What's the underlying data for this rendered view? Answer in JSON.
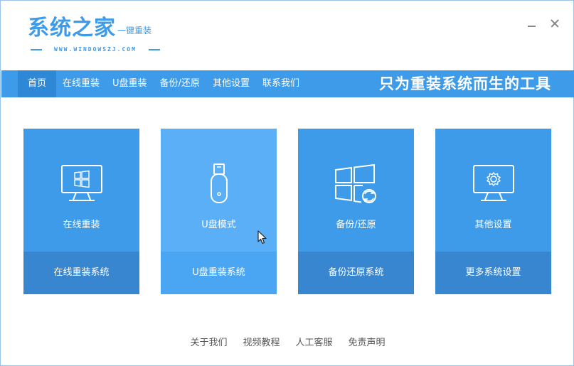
{
  "app": {
    "logo_title": "系统之家",
    "logo_subtitle": "一键重装",
    "logo_url": "WWW.WINDOWSZJ.COM"
  },
  "nav": {
    "items": [
      {
        "label": "首页",
        "active": true
      },
      {
        "label": "在线重装",
        "active": false
      },
      {
        "label": "U盘重装",
        "active": false
      },
      {
        "label": "备份/还原",
        "active": false
      },
      {
        "label": "其他设置",
        "active": false
      },
      {
        "label": "联系我们",
        "active": false
      }
    ],
    "slogan": "只为重装系统而生的工具"
  },
  "cards": [
    {
      "title": "在线重装",
      "subtitle": "在线重装系统",
      "icon": "monitor-windows-icon",
      "hovered": false
    },
    {
      "title": "U盘模式",
      "subtitle": "U盘重装系统",
      "icon": "usb-drive-icon",
      "hovered": true
    },
    {
      "title": "备份/还原",
      "subtitle": "备份还原系统",
      "icon": "windows-restore-icon",
      "hovered": false
    },
    {
      "title": "其他设置",
      "subtitle": "更多系统设置",
      "icon": "monitor-gear-icon",
      "hovered": false
    }
  ],
  "footer": {
    "links": [
      "关于我们",
      "视频教程",
      "人工客服",
      "免责声明"
    ]
  },
  "colors": {
    "primary": "#3d9be9",
    "card_bottom": "#3886cf",
    "card_hover": "#5aaff7",
    "nav_active": "#2f88d6"
  }
}
